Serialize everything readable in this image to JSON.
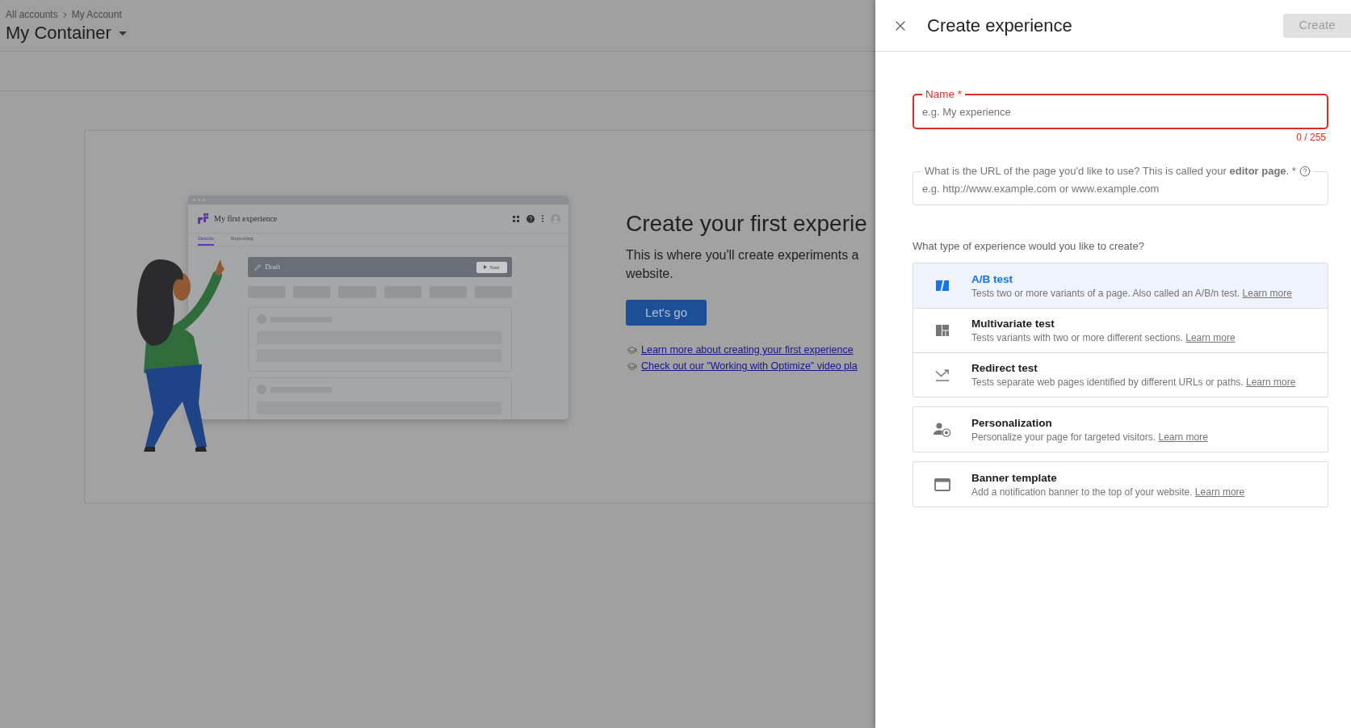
{
  "header": {
    "breadcrumbs": [
      "All accounts",
      "My Account"
    ],
    "title": "My Container"
  },
  "empty_state": {
    "mockup": {
      "title": "My first experience",
      "tabs": [
        {
          "label": "Details",
          "selected": true
        },
        {
          "label": "Reporting",
          "selected": false
        }
      ],
      "status": "Draft",
      "action": "Start"
    },
    "heading": "Create your first experie",
    "description_lines": [
      "This is where you'll create experiments a",
      "website."
    ],
    "button": "Let's go",
    "links": [
      "Learn more about creating your first experience",
      "Check out our \"Working with Optimize\" video pla"
    ]
  },
  "panel": {
    "title": "Create experience",
    "create_button": {
      "label": "Create",
      "disabled": true
    },
    "name_field": {
      "label": "Name *",
      "placeholder": "e.g. My experience",
      "counter": "0 / 255",
      "invalid": true
    },
    "url_field": {
      "label": "What is the URL of the page you'd like to use? This is called your **editor page**. *",
      "placeholder": "e.g. http://www.example.com or www.example.com"
    },
    "type_prompt": "What type of experience would you like to create?",
    "type_groups": [
      {
        "options": [
          {
            "kind": "ab",
            "title": "A/B test",
            "description": "Tests two or more variants of a page. Also called an A/B/n test.",
            "link": "Learn more",
            "selected": true
          },
          {
            "kind": "multivariate",
            "title": "Multivariate test",
            "description": "Tests variants with two or more different sections.",
            "link": "Learn more",
            "selected": false
          },
          {
            "kind": "redirect",
            "title": "Redirect test",
            "description": "Tests separate web pages identified by different URLs or paths.",
            "link": "Learn more",
            "selected": false
          }
        ]
      },
      {
        "options": [
          {
            "kind": "personalization",
            "title": "Personalization",
            "description": "Personalize your page for targeted visitors.",
            "link": "Learn more",
            "selected": false
          }
        ]
      },
      {
        "options": [
          {
            "kind": "banner",
            "title": "Banner template",
            "description": "Add a notification banner to the top of your website.",
            "link": "Learn more",
            "selected": false
          }
        ]
      }
    ]
  }
}
